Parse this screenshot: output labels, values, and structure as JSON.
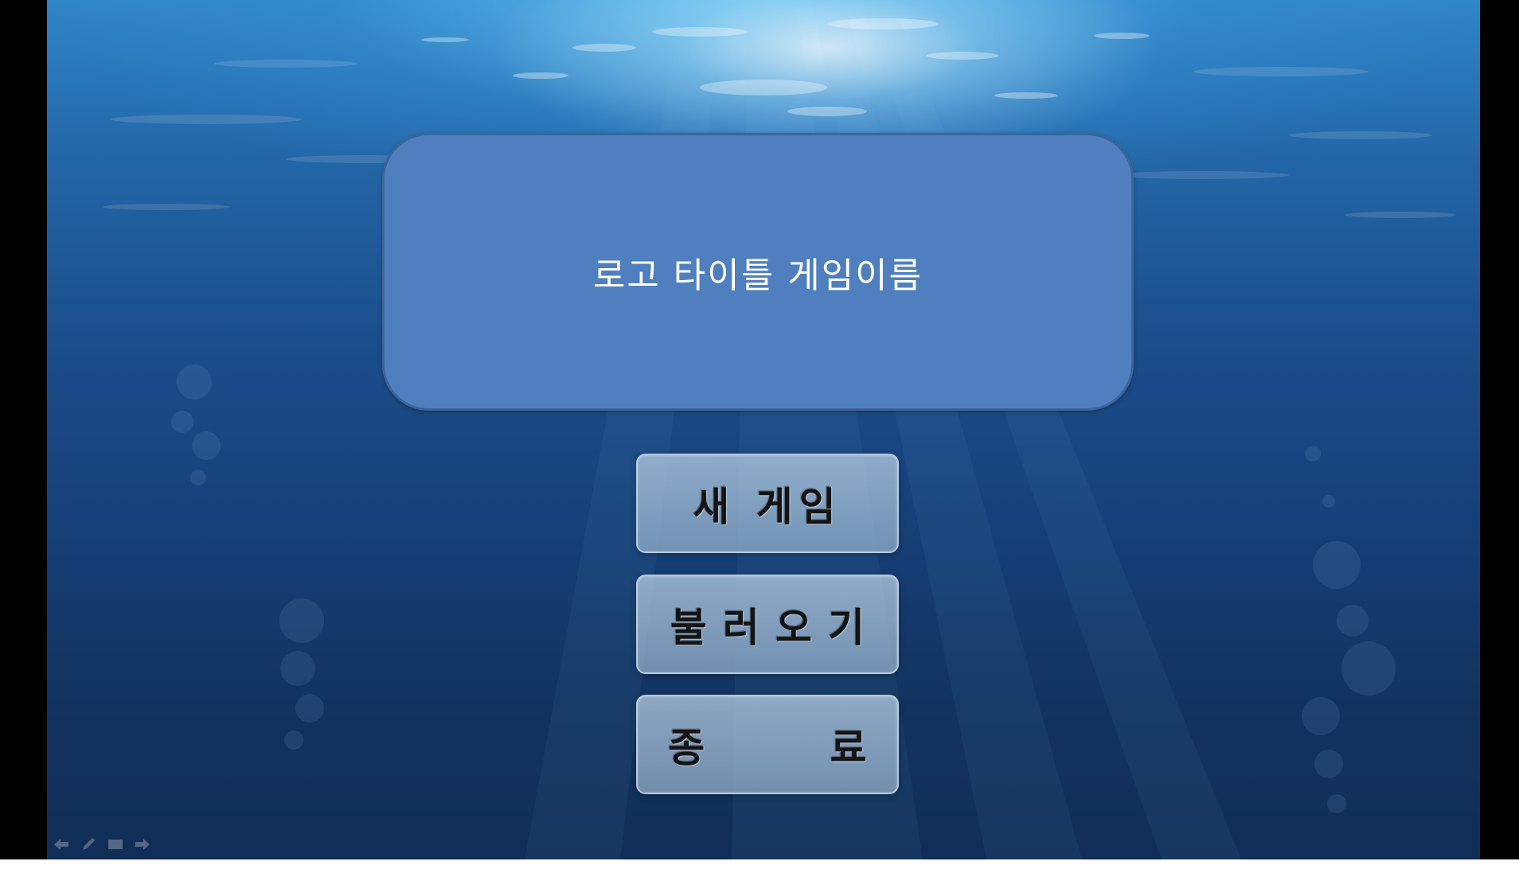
{
  "title_screen": {
    "logo_title": "로고 타이틀 게임이름",
    "menu": {
      "new_game": "새 게임",
      "load_game": "불러오기",
      "exit": "종 료"
    }
  },
  "slideshow_controls": [
    {
      "name": "previous-slide-icon"
    },
    {
      "name": "pen-icon"
    },
    {
      "name": "slide-menu-icon"
    },
    {
      "name": "next-slide-icon"
    }
  ],
  "colors": {
    "logo_box": "#4f7fbf",
    "button_fill": "#a9c2db",
    "water_top": "#2f86c8",
    "water_bottom": "#112e57"
  }
}
